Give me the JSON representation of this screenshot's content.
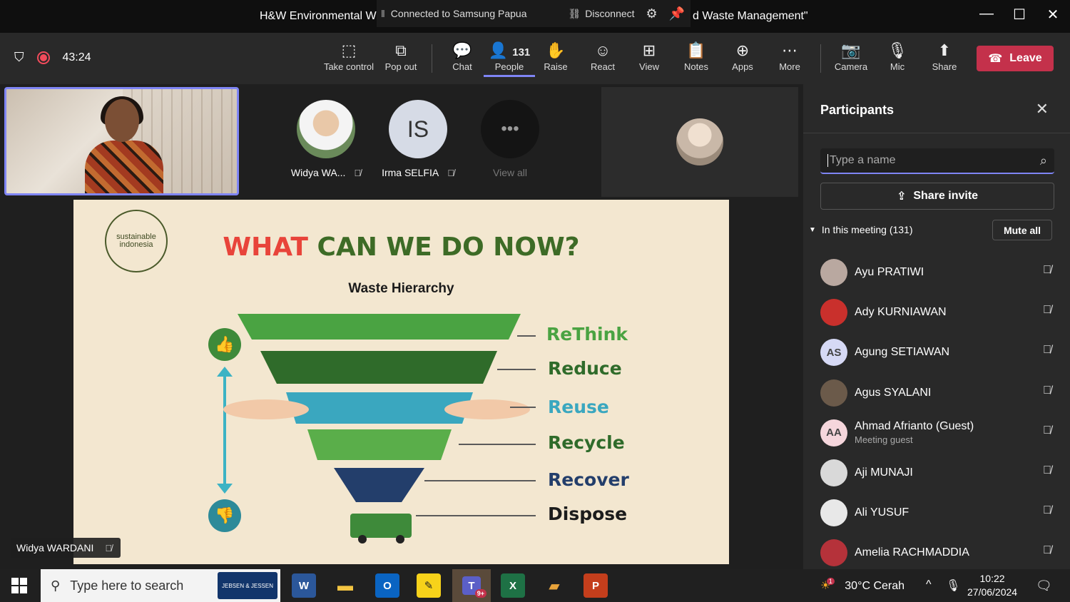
{
  "title_bar": {
    "title_left": "H&W Environmental W",
    "title_right": "d Waste Management\"",
    "connection_text": "Connected to Samsung Papua",
    "disconnect_label": "Disconnect"
  },
  "toolbar": {
    "timer": "43:24",
    "buttons": [
      {
        "label": "Take control"
      },
      {
        "label": "Pop out"
      },
      {
        "label": "Chat"
      },
      {
        "label": "People",
        "count": "131"
      },
      {
        "label": "Raise"
      },
      {
        "label": "React"
      },
      {
        "label": "View"
      },
      {
        "label": "Notes"
      },
      {
        "label": "Apps"
      },
      {
        "label": "More"
      },
      {
        "label": "Camera"
      },
      {
        "label": "Mic"
      },
      {
        "label": "Share"
      }
    ],
    "leave_label": "Leave"
  },
  "stage": {
    "tiles": [
      {
        "name": "Widya WA...",
        "initials": ""
      },
      {
        "name": "Irma SELFIA",
        "initials": "IS"
      },
      {
        "name": "View all",
        "initials": ""
      }
    ],
    "speaker_tag": "Widya WARDANI"
  },
  "slide": {
    "logo_line1": "sustainable",
    "logo_line2": "indonesia",
    "title_red": "WHAT",
    "title_green": "CAN WE DO NOW?",
    "subtitle": "Waste Hierarchy",
    "tiers": [
      {
        "label": "ReThink",
        "color": "#4aa342"
      },
      {
        "label": "Reduce",
        "color": "#2f6b2a"
      },
      {
        "label": "Reuse",
        "color": "#3aa7bf"
      },
      {
        "label": "Recycle",
        "color": "#2f6b2a"
      },
      {
        "label": "Recover",
        "color": "#233e6b"
      },
      {
        "label": "Dispose",
        "color": "#1c1c1c"
      }
    ]
  },
  "participants": {
    "heading": "Participants",
    "search_placeholder": "Type a name",
    "share_invite_label": "Share invite",
    "in_meeting_label": "In this meeting (131)",
    "mute_all_label": "Mute all",
    "people": [
      {
        "name": "Ayu PRATIWI",
        "initials": "",
        "subtitle": "",
        "avatar_color": "#b9a8a0"
      },
      {
        "name": "Ady KURNIAWAN",
        "initials": "",
        "subtitle": "",
        "avatar_color": "#c9302c"
      },
      {
        "name": "Agung SETIAWAN",
        "initials": "AS",
        "subtitle": "",
        "avatar_color": "#d6d9f5"
      },
      {
        "name": "Agus SYALANI",
        "initials": "",
        "subtitle": "",
        "avatar_color": "#6b5a4a"
      },
      {
        "name": "Ahmad Afrianto (Guest)",
        "initials": "AA",
        "subtitle": "Meeting guest",
        "avatar_color": "#f5d6dc"
      },
      {
        "name": "Aji MUNAJI",
        "initials": "",
        "subtitle": "",
        "avatar_color": "#d9d9d9"
      },
      {
        "name": "Ali YUSUF",
        "initials": "",
        "subtitle": "",
        "avatar_color": "#e8e8e8"
      },
      {
        "name": "Amelia RACHMADDIA",
        "initials": "",
        "subtitle": "",
        "avatar_color": "#b5323a"
      }
    ]
  },
  "taskbar": {
    "search_placeholder": "Type here to search",
    "pinned_logo_text": "JEBSEN & JESSEN",
    "teams_badge": "9+",
    "weather_badge": "1",
    "weather": "30°C  Cerah",
    "time": "10:22",
    "date": "27/06/2024"
  },
  "colors": {
    "accent": "#7f85f5",
    "leave": "#c4314b",
    "panel_bg": "#292929"
  }
}
